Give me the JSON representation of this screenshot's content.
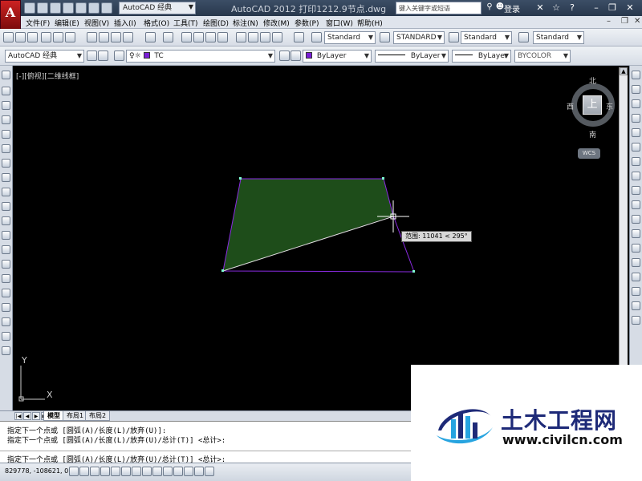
{
  "window": {
    "app_button": "A",
    "workspace": "AutoCAD 经典",
    "title": "AutoCAD 2012    打印1212.9节点.dwg",
    "search_placeholder": "键入关键字或短语",
    "login": "登录",
    "help": "?"
  },
  "menu": [
    "文件(F)",
    "编辑(E)",
    "视图(V)",
    "插入(I)",
    "格式(O)",
    "工具(T)",
    "绘图(D)",
    "标注(N)",
    "修改(M)",
    "参数(P)",
    "窗口(W)",
    "帮助(H)"
  ],
  "styles": {
    "text_style": "Standard",
    "dim_style": "STANDARD",
    "table_style": "Standard",
    "mleader_style": "Standard"
  },
  "layers": {
    "workspace": "AutoCAD 经典",
    "current_layer": "TC",
    "color": "ByLayer",
    "linetype": "ByLayer",
    "lineweight": "ByLayer",
    "plot_style": "BYCOLOR",
    "layer_color": "#7a1fd6"
  },
  "viewport": {
    "label": "[-][俯视][二维线框]"
  },
  "viewcube": {
    "top": "上",
    "north": "北",
    "south": "南",
    "east": "东",
    "west": "西",
    "wcs": "WCS"
  },
  "tooltip": "范围: 11041 < 295°",
  "ucs": {
    "x": "X",
    "y": "Y"
  },
  "tabs": {
    "model": "模型",
    "layout1": "布局1",
    "layout2": "布局2"
  },
  "command": {
    "history": [
      "指定下一个点或 [圆弧(A)/长度(L)/放弃(U)]:",
      "指定下一个点或 [圆弧(A)/长度(L)/放弃(U)/总计(T)] <总计>:"
    ],
    "prompt": "指定下一个点或 [圆弧(A)/长度(L)/放弃(U)/总计(T)] <总计>:"
  },
  "status": {
    "coords": "829778, -108621, 0"
  },
  "watermark": {
    "brand": "土木工程网",
    "url": "www.civilcn.com"
  },
  "colors": {
    "fill": "#1e4d1a",
    "polyline": "#8a2be2",
    "rubberband": "#e0e0e0",
    "grip": "#7fffd4"
  }
}
